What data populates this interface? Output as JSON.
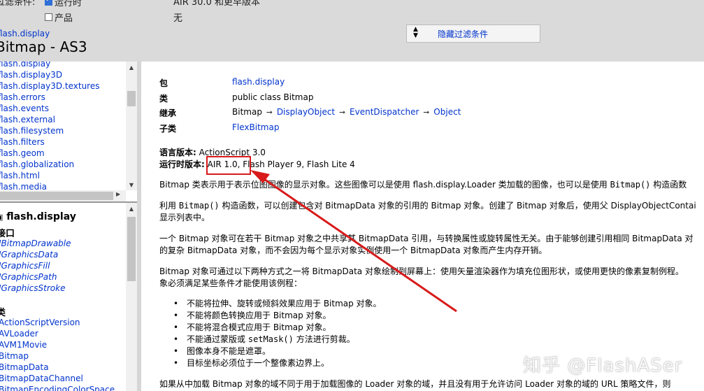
{
  "header": {
    "filter_label": "过滤条件:",
    "runtime_checkbox": "运行时",
    "product_checkbox": "产品",
    "runtime_value": "AIR 30.0 和更早版本",
    "product_value": "无",
    "package_link": "flash.display",
    "page_title": "Bitmap  - AS3",
    "hide_filters": "隐藏过滤条件"
  },
  "package_list": [
    "flash.display",
    "flash.display3D",
    "flash.display3D.textures",
    "flash.errors",
    "flash.events",
    "flash.external",
    "flash.filesystem",
    "flash.filters",
    "flash.geom",
    "flash.globalization",
    "flash.html",
    "flash.media"
  ],
  "package_nav": {
    "title": "flash.display",
    "interfaces_heading": "接口",
    "interfaces": [
      "IBitmapDrawable",
      "IGraphicsData",
      "IGraphicsFill",
      "IGraphicsPath",
      "IGraphicsStroke"
    ],
    "classes_heading": "类",
    "classes": [
      "ActionScriptVersion",
      "AVLoader",
      "AVM1Movie",
      "Bitmap",
      "BitmapData",
      "BitmapDataChannel",
      "BitmapEncodingColorSpace"
    ]
  },
  "class_info": {
    "package_label": "包",
    "package_value": "flash.display",
    "class_label": "类",
    "class_value": "public class Bitmap",
    "inheritance_label": "继承",
    "inheritance": [
      "Bitmap",
      "DisplayObject",
      "EventDispatcher",
      "Object"
    ],
    "subclasses_label": "子类",
    "subclass": "FlexBitmap",
    "lang_label": "语言版本:",
    "lang_value": "ActionScript 3.0",
    "runtime_label": "运行时版本:",
    "runtime_highlight": "AIR 1.0,",
    "runtime_rest": "Flash Player 9, Flash Lite 4"
  },
  "description": {
    "p1_a": "Bitmap 类表示用于表示位图图像的显示对象。这些图像可以是使用 flash.display.Loader 类加载的图像，也可以是使用",
    "p1_code": "Bitmap()",
    "p1_b": "构造函数",
    "p2_a": "利用",
    "p2_code": "Bitmap()",
    "p2_b": "构造函数，可以创建包含对 BitmapData 对象的引用的 Bitmap 对象。创建了 Bitmap 对象后，使用父 DisplayObjectContai",
    "p2_c": "显示列表中。",
    "p3_a": "一个 Bitmap 对象可在若干 Bitmap 对象之中共享其 BitmapData 引用，与转换属性或旋转属性无关。由于能够创建引用相同 BitmapData 对",
    "p3_b": "的复杂 BitmapData 对象，而不会因为每个显示对象实例使用一个 BitmapData 对象而产生内存开销。",
    "p4_a": "Bitmap 对象可通过以下两种方式之一将 BitmapData 对象绘制到屏幕上：使用矢量渲染器作为填充位图形状，或使用更快的像素复制例程。",
    "p4_b": "象必须满足某些条件才能使用该例程：",
    "bullets": [
      {
        "text": "不能将拉伸、旋转或倾斜效果应用于 Bitmap 对象。"
      },
      {
        "text": "不能将颜色转换应用于 Bitmap 对象。"
      },
      {
        "text": "不能将混合模式应用于 Bitmap 对象。"
      },
      {
        "pre": "不能通过蒙版或",
        "code": "setMask()",
        "post": "方法进行剪裁。"
      },
      {
        "text": "图像本身不能是遮罩。"
      },
      {
        "text": "目标坐标必须位于一个整像素边界上。"
      }
    ],
    "p5": "如果从中加载 Bitmap 对象的域不同于用于加载图像的 Loader 对象的域，并且没有用于允许访问 Loader 对象的域的 URL 策略文件，则"
  },
  "watermark": "知乎 @FlashASer",
  "colors": {
    "link": "#0033cc",
    "annotation": "#d81a1a",
    "header_bg": "#dadada"
  }
}
